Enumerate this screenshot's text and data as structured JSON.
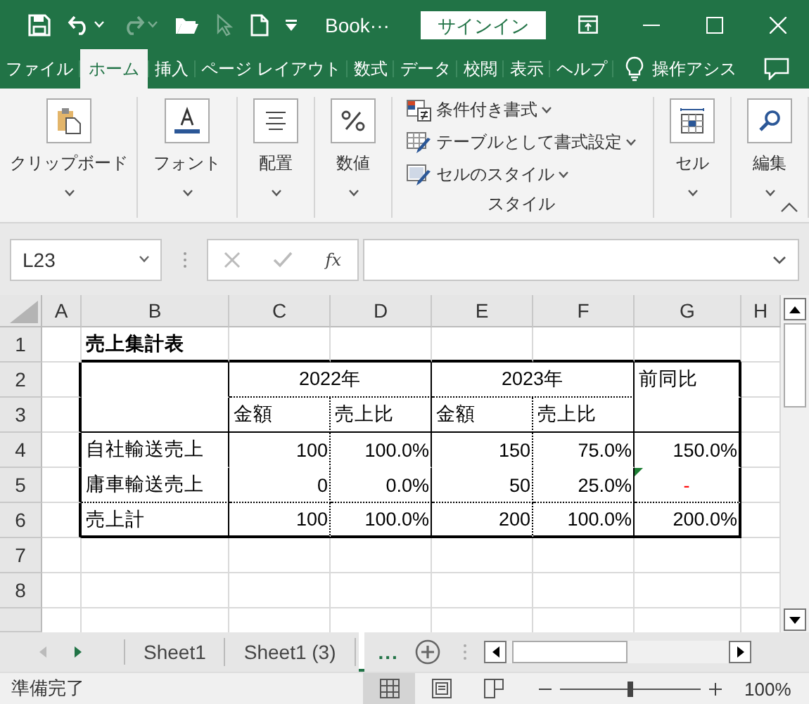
{
  "title_bar": {
    "quick_access": [
      {
        "kind": "save",
        "disabled": false
      },
      {
        "kind": "undo",
        "disabled": false
      },
      {
        "kind": "redo",
        "disabled": true
      },
      {
        "kind": "open",
        "disabled": false
      },
      {
        "kind": "pointer",
        "disabled": true
      },
      {
        "kind": "new",
        "disabled": false
      },
      {
        "kind": "customize",
        "disabled": false
      }
    ],
    "file_name": "Book···",
    "sign_in": "サインイン"
  },
  "ribbon_tabs": [
    {
      "label": "ファイル",
      "selected": false
    },
    {
      "label": "ホーム",
      "selected": true
    },
    {
      "label": "挿入",
      "selected": false
    },
    {
      "label": "ページ レイアウト",
      "selected": false
    },
    {
      "label": "数式",
      "selected": false
    },
    {
      "label": "データ",
      "selected": false
    },
    {
      "label": "校閲",
      "selected": false
    },
    {
      "label": "表示",
      "selected": false
    },
    {
      "label": "ヘルプ",
      "selected": false
    }
  ],
  "tell_me": "操作アシス",
  "ribbon_groups": [
    {
      "kind": "button",
      "label": "クリップボード"
    },
    {
      "kind": "button",
      "label": "フォント"
    },
    {
      "kind": "button",
      "label": "配置"
    },
    {
      "kind": "button",
      "label": "数値"
    },
    {
      "kind": "list",
      "label": "スタイル",
      "items": [
        {
          "label": "条件付き書式"
        },
        {
          "label": "テーブルとして書式設定"
        },
        {
          "label": "セルのスタイル"
        }
      ]
    },
    {
      "kind": "button",
      "label": "セル"
    },
    {
      "kind": "button",
      "label": "編集"
    }
  ],
  "formula_bar": {
    "name_box": "L23",
    "function_label": "fx"
  },
  "columns": [
    "A",
    "B",
    "C",
    "D",
    "E",
    "F",
    "G",
    "H"
  ],
  "rows": [
    {
      "number": "1",
      "cells": [
        null,
        {
          "text": "売上集計表",
          "kind": "title"
        }
      ]
    },
    {
      "number": "2",
      "cells": [
        null,
        null,
        {
          "text": "2022年",
          "kind": "group_header"
        },
        {
          "text": "2023年",
          "kind": "group_header"
        },
        {
          "text": "前同比",
          "kind": "label"
        },
        null
      ]
    },
    {
      "number": "3",
      "cells": [
        null,
        null,
        {
          "text": "金額",
          "kind": "label"
        },
        {
          "text": "売上比",
          "kind": "label"
        },
        {
          "text": "金額",
          "kind": "label"
        },
        {
          "text": "売上比",
          "kind": "label"
        },
        null,
        null
      ]
    },
    {
      "number": "4",
      "cells": [
        null,
        {
          "text": "自社輸送売上",
          "kind": "label"
        },
        {
          "text": "100",
          "kind": "number"
        },
        {
          "text": "100.0%",
          "kind": "number"
        },
        {
          "text": "150",
          "kind": "number"
        },
        {
          "text": "75.0%",
          "kind": "number"
        },
        {
          "text": "150.0%",
          "kind": "number"
        },
        null
      ]
    },
    {
      "number": "5",
      "cells": [
        null,
        {
          "text": "庸車輸送売上",
          "kind": "label"
        },
        {
          "text": "0",
          "kind": "number"
        },
        {
          "text": "0.0%",
          "kind": "number"
        },
        {
          "text": "50",
          "kind": "number"
        },
        {
          "text": "25.0%",
          "kind": "number"
        },
        {
          "text": "-",
          "kind": "center",
          "color": "#ff0000",
          "error_flag": true
        },
        null
      ]
    },
    {
      "number": "6",
      "cells": [
        null,
        {
          "text": "売上計",
          "kind": "label"
        },
        {
          "text": "100",
          "kind": "number"
        },
        {
          "text": "100.0%",
          "kind": "number"
        },
        {
          "text": "200",
          "kind": "number"
        },
        {
          "text": "100.0%",
          "kind": "number"
        },
        {
          "text": "200.0%",
          "kind": "number"
        },
        null
      ]
    },
    {
      "number": "7",
      "cells": []
    },
    {
      "number": "8",
      "cells": []
    }
  ],
  "sheet_tabs": [
    {
      "label": "Sheet1",
      "selected": false
    },
    {
      "label": "Sheet1 (3)",
      "selected": false
    }
  ],
  "more_sheets": "...",
  "status_text": "準備完了",
  "views": [
    {
      "kind": "normal",
      "selected": true
    },
    {
      "kind": "page_layout",
      "selected": false
    },
    {
      "kind": "page_break",
      "selected": false
    }
  ],
  "zoom": {
    "level": 0.5,
    "reading": "100%"
  }
}
